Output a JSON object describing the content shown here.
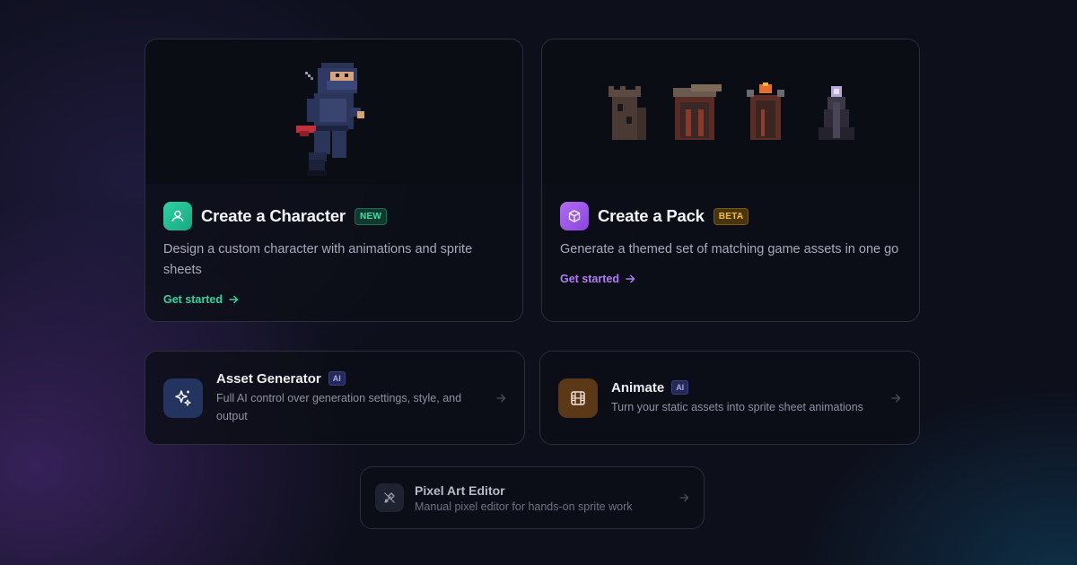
{
  "cards": {
    "character": {
      "title": "Create a Character",
      "badge": "NEW",
      "description": "Design a custom character with animations and sprite sheets",
      "cta": "Get started",
      "accent": "#34d39b"
    },
    "pack": {
      "title": "Create a Pack",
      "badge": "BETA",
      "description": "Generate a themed set of matching game assets in one go",
      "cta": "Get started",
      "accent": "#b07cf6"
    },
    "asset_generator": {
      "title": "Asset Generator",
      "badge": "AI",
      "description": "Full AI control over generation settings, style, and output",
      "icon": "sparkles-icon"
    },
    "animate": {
      "title": "Animate",
      "badge": "AI",
      "description": "Turn your static assets into sprite sheet animations",
      "icon": "film-icon"
    },
    "pixel_editor": {
      "title": "Pixel Art Editor",
      "description": "Manual pixel editor for hands-on sprite work",
      "icon": "brush-icon"
    }
  }
}
